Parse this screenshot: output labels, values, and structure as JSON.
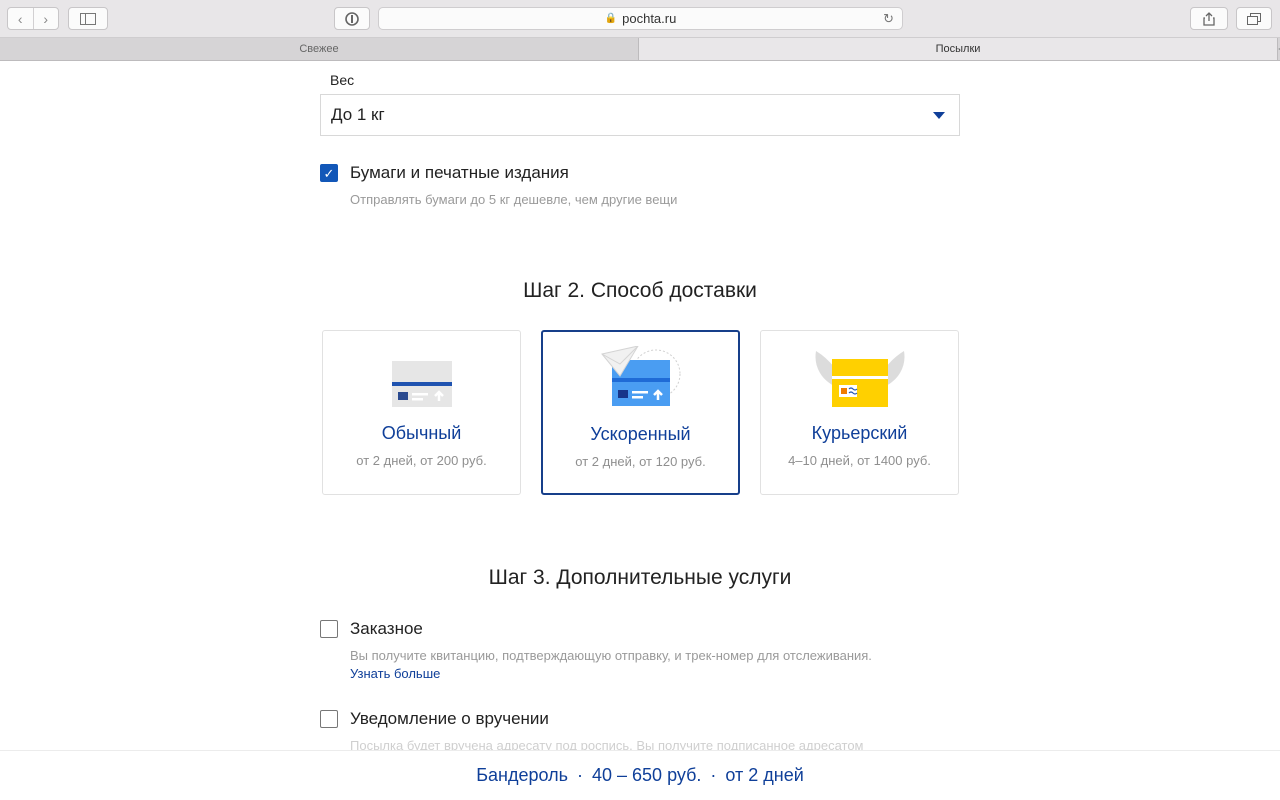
{
  "browser": {
    "address": "pochta.ru",
    "tabs": [
      {
        "label": "Свежее",
        "active": false
      },
      {
        "label": "Посылки",
        "active": true
      }
    ]
  },
  "form": {
    "weight_label": "Вес",
    "weight_value": "До 1 кг",
    "papers": {
      "checked": true,
      "title": "Бумаги и печатные издания",
      "desc": "Отправлять бумаги до 5 кг дешевле, чем другие вещи"
    }
  },
  "step2": {
    "title": "Шаг 2. Способ доставки",
    "options": [
      {
        "title": "Обычный",
        "subtitle": "от 2 дней, от 200 руб.",
        "selected": false
      },
      {
        "title": "Ускоренный",
        "subtitle": "от 2 дней, от 120 руб.",
        "selected": true
      },
      {
        "title": "Курьерский",
        "subtitle": "4–10 дней, от 1400 руб.",
        "selected": false
      }
    ]
  },
  "step3": {
    "title": "Шаг 3. Дополнительные услуги",
    "services": [
      {
        "title": "Заказное",
        "desc": "Вы получите квитанцию, подтверждающую отправку, и трек-номер для отслеживания.",
        "link": "Узнать больше",
        "checked": false
      },
      {
        "title": "Уведомление о вручении",
        "desc": "Посылка будет вручена адресату под роспись. Вы получите подписанное адресатом",
        "checked": false
      }
    ]
  },
  "summary": {
    "type": "Бандероль",
    "price": "40 – 650 руб.",
    "term": "от 2 дней",
    "separator": "·"
  },
  "colors": {
    "accent": "#0f3f99",
    "checkbox": "#1257b8",
    "yellow": "#ffd000",
    "blue": "#4a9df2"
  }
}
